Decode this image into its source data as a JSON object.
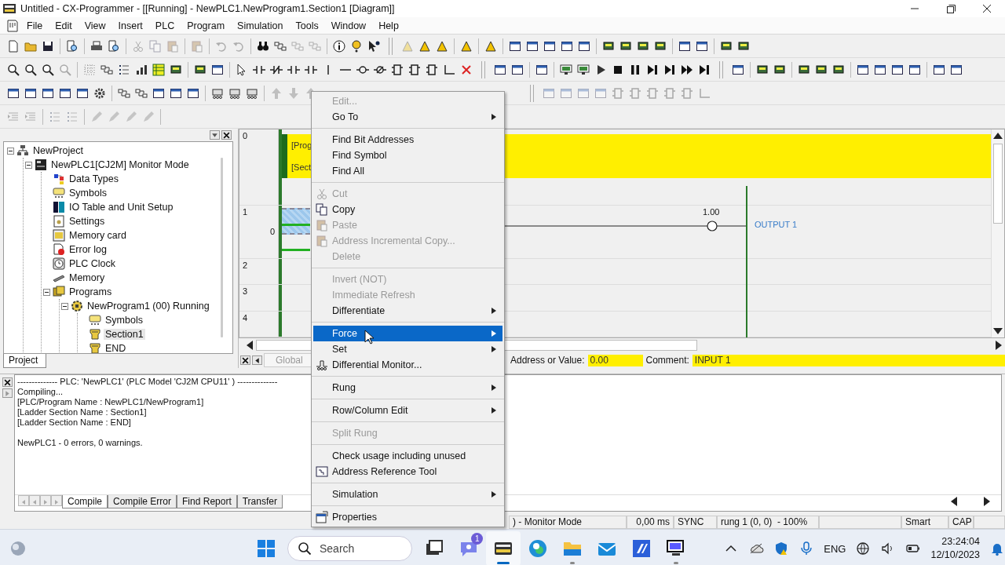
{
  "window": {
    "title": "Untitled - CX-Programmer - [[Running] - NewPLC1.NewProgram1.Section1 [Diagram]]"
  },
  "menus": [
    "File",
    "Edit",
    "View",
    "Insert",
    "PLC",
    "Program",
    "Simulation",
    "Tools",
    "Window",
    "Help"
  ],
  "project_pane": {
    "tab": "Project",
    "tree": [
      {
        "label": "NewProject",
        "kind": "project",
        "selected": false,
        "expanded": true,
        "children": [
          {
            "label": "NewPLC1[CJ2M] Monitor Mode",
            "kind": "plc",
            "selected": false,
            "expanded": true,
            "children": [
              {
                "label": "Data Types",
                "kind": "datatypes",
                "selected": false
              },
              {
                "label": "Symbols",
                "kind": "symbols",
                "selected": false
              },
              {
                "label": "IO Table and Unit Setup",
                "kind": "io",
                "selected": false
              },
              {
                "label": "Settings",
                "kind": "settings",
                "selected": false
              },
              {
                "label": "Memory card",
                "kind": "card",
                "selected": false
              },
              {
                "label": "Error log",
                "kind": "errorlog",
                "selected": false
              },
              {
                "label": "PLC Clock",
                "kind": "clock",
                "selected": false
              },
              {
                "label": "Memory",
                "kind": "memory",
                "selected": false
              },
              {
                "label": "Programs",
                "kind": "programs",
                "selected": false,
                "expanded": true,
                "children": [
                  {
                    "label": "NewProgram1 (00) Running",
                    "kind": "program",
                    "selected": false,
                    "expanded": true,
                    "children": [
                      {
                        "label": "Symbols",
                        "kind": "symbols",
                        "selected": false
                      },
                      {
                        "label": "Section1",
                        "kind": "section",
                        "selected": true
                      },
                      {
                        "label": "END",
                        "kind": "section",
                        "selected": false
                      }
                    ]
                  }
                ]
              }
            ]
          }
        ]
      }
    ]
  },
  "diagram": {
    "rungs": [
      {
        "number": "0",
        "comment": [
          "[Prog",
          "[Sect"
        ]
      },
      {
        "number": "1",
        "step": "0",
        "selected": true,
        "coil": {
          "address": "1.00",
          "comment": "OUTPUT 1"
        }
      },
      {
        "number": "2"
      },
      {
        "number": "3"
      },
      {
        "number": "4"
      }
    ],
    "tab": "Global",
    "address_label": "Address or Value:",
    "address_value": "0.00",
    "comment_label": "Comment:",
    "comment_value": "INPUT 1"
  },
  "context_menu": {
    "groups": [
      [
        {
          "label": "Edit...",
          "kind": "text",
          "disabled": true,
          "submenu": false,
          "selected": false
        },
        {
          "label": "Go To",
          "kind": "text",
          "disabled": false,
          "submenu": true,
          "selected": false
        }
      ],
      [
        {
          "label": "Find Bit Addresses",
          "kind": "text",
          "disabled": false,
          "submenu": false,
          "selected": false
        },
        {
          "label": "Find Symbol",
          "kind": "text",
          "disabled": false,
          "submenu": false,
          "selected": false
        },
        {
          "label": "Find All",
          "kind": "text",
          "disabled": false,
          "submenu": false,
          "selected": false
        }
      ],
      [
        {
          "label": "Cut",
          "kind": "cut",
          "disabled": true,
          "submenu": false,
          "selected": false
        },
        {
          "label": "Copy",
          "kind": "copy",
          "disabled": false,
          "submenu": false,
          "selected": false
        },
        {
          "label": "Paste",
          "kind": "paste",
          "disabled": true,
          "submenu": false,
          "selected": false
        },
        {
          "label": "Address Incremental Copy...",
          "kind": "paste",
          "disabled": true,
          "submenu": false,
          "selected": false
        },
        {
          "label": "Delete",
          "kind": "text",
          "disabled": true,
          "submenu": false,
          "selected": false
        }
      ],
      [
        {
          "label": "Invert (NOT)",
          "kind": "text",
          "disabled": true,
          "submenu": false,
          "selected": false
        },
        {
          "label": "Immediate Refresh",
          "kind": "text",
          "disabled": true,
          "submenu": false,
          "selected": false
        },
        {
          "label": "Differentiate",
          "kind": "text",
          "disabled": false,
          "submenu": true,
          "selected": false
        }
      ],
      [
        {
          "label": "Force",
          "kind": "text",
          "disabled": false,
          "submenu": true,
          "selected": true
        },
        {
          "label": "Set",
          "kind": "text",
          "disabled": false,
          "submenu": true,
          "selected": false
        },
        {
          "label": "Differential Monitor...",
          "kind": "monitor",
          "disabled": false,
          "submenu": false,
          "selected": false
        }
      ],
      [
        {
          "label": "Rung",
          "kind": "text",
          "disabled": false,
          "submenu": true,
          "selected": false
        }
      ],
      [
        {
          "label": "Row/Column Edit",
          "kind": "text",
          "disabled": false,
          "submenu": true,
          "selected": false
        }
      ],
      [
        {
          "label": "Split Rung",
          "kind": "text",
          "disabled": true,
          "submenu": false,
          "selected": false
        }
      ],
      [
        {
          "label": "Check usage including unused",
          "kind": "text",
          "disabled": false,
          "submenu": false,
          "selected": false
        },
        {
          "label": "Address Reference Tool",
          "kind": "reference",
          "disabled": false,
          "submenu": false,
          "selected": false
        }
      ],
      [
        {
          "label": "Simulation",
          "kind": "text",
          "disabled": false,
          "submenu": true,
          "selected": false
        }
      ],
      [
        {
          "label": "Properties",
          "kind": "properties",
          "disabled": false,
          "submenu": false,
          "selected": false
        }
      ]
    ]
  },
  "output": {
    "lines": [
      "-------------- PLC: 'NewPLC1' (PLC Model 'CJ2M CPU11' ) --------------",
      "Compiling...",
      "[PLC/Program Name : NewPLC1/NewProgram1]",
      "[Ladder Section Name : Section1]",
      "[Ladder Section Name : END]"
    ],
    "summary": "NewPLC1 - 0 errors, 0 warnings.",
    "tabs": [
      {
        "label": "Compile",
        "selected": true
      },
      {
        "label": "Compile Error",
        "selected": false
      },
      {
        "label": "Find Report",
        "selected": false
      },
      {
        "label": "Transfer",
        "selected": false
      }
    ]
  },
  "status_bar": [
    ") - Monitor Mode",
    "0,00 ms",
    "SYNC",
    "rung 1 (0, 0)  - 100%",
    "Smart",
    "CAP"
  ],
  "taskbar": {
    "search": {
      "placeholder": "Search"
    },
    "apps": [
      {
        "kind": "taskview",
        "active": false,
        "running": false
      },
      {
        "kind": "chat",
        "active": false,
        "running": false,
        "badge": "1"
      },
      {
        "kind": "plc",
        "active": true,
        "running": true
      },
      {
        "kind": "browser",
        "active": false,
        "running": false
      },
      {
        "kind": "files",
        "active": false,
        "running": true
      },
      {
        "kind": "mail",
        "active": false,
        "running": false
      },
      {
        "kind": "studio",
        "active": false,
        "running": false
      },
      {
        "kind": "monitor",
        "active": false,
        "running": true
      }
    ],
    "language": "ENG",
    "time": "23:24:04",
    "date": "12/10/2023"
  }
}
